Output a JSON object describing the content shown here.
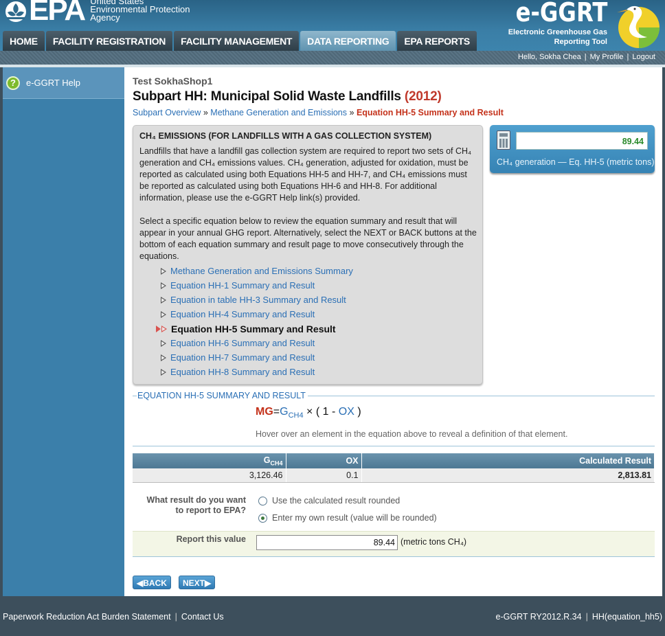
{
  "header": {
    "epa_wordmark": "EPA",
    "agency_line1": "United States",
    "agency_line2": "Environmental Protection",
    "agency_line3": "Agency",
    "app_wordmark": "e-GGRT",
    "app_subtitle_line1": "Electronic Greenhouse Gas",
    "app_subtitle_line2": "Reporting Tool"
  },
  "nav": {
    "tabs": [
      {
        "label": "HOME"
      },
      {
        "label": "FACILITY REGISTRATION"
      },
      {
        "label": "FACILITY MANAGEMENT"
      },
      {
        "label": "DATA REPORTING"
      },
      {
        "label": "EPA REPORTS"
      }
    ],
    "active_tab": "DATA REPORTING"
  },
  "userbar": {
    "greeting": "Hello, Sokha Chea",
    "profile": "My Profile",
    "logout": "Logout"
  },
  "sidebar": {
    "help_label": "e-GGRT Help"
  },
  "main": {
    "facility_name": "Test SokhaShop1",
    "title": "Subpart HH: Municipal Solid Waste Landfills",
    "title_year": "(2012)",
    "breadcrumb": {
      "item1": "Subpart Overview",
      "item2": "Methane Generation and Emissions",
      "current": "Equation HH-5 Summary and Result",
      "separator": "»"
    }
  },
  "info_box": {
    "title": "CH₄ EMISSIONS (FOR LANDFILLS WITH A GAS COLLECTION SYSTEM)",
    "paragraph1": "Landfills that have a landfill gas collection system are required to report two sets of CH₄ generation and CH₄ emissions values. CH₄ generation, adjusted for oxidation, must be reported as calculated using both Equations HH-5 and HH-7, and CH₄ emissions must be reported as calculated using both Equations HH-6 and HH-8. For additional information, please use the e-GGRT Help link(s) provided.",
    "paragraph2": "Select a specific equation below to review the equation summary and result that will appear in your annual GHG report. Alternatively, select the NEXT or BACK buttons at the bottom of each equation summary and result page to move consecutively through the equations.",
    "links": [
      {
        "label": "Methane Generation and Emissions Summary"
      },
      {
        "label": "Equation HH-1 Summary and Result"
      },
      {
        "label": "Equation in table HH-3 Summary and Result"
      },
      {
        "label": "Equation HH-4 Summary and Result"
      },
      {
        "label": "Equation HH-5 Summary and Result"
      },
      {
        "label": "Equation HH-6 Summary and Result"
      },
      {
        "label": "Equation HH-7 Summary and Result"
      },
      {
        "label": "Equation HH-8 Summary and Result"
      }
    ]
  },
  "result_box": {
    "value": "89.44",
    "caption": "CH₄ generation — Eq. HH-5 (metric tons)"
  },
  "equation": {
    "section_label": "EQUATION HH-5 SUMMARY AND RESULT",
    "result_var": "MG",
    "equals": "=",
    "g_var": "G",
    "g_sub": "CH4",
    "times": "×",
    "open": "(",
    "one": "1",
    "minus": "-",
    "ox_var": "OX",
    "close": ")",
    "hover_hint": "Hover over an element in the equation above to reveal a definition of that element."
  },
  "data_table": {
    "headers": {
      "g": "G",
      "g_sub": "CH4",
      "ox": "OX",
      "result": "Calculated Result"
    },
    "row": {
      "g": "3,126.46",
      "ox": "0.1",
      "result": "2,813.81"
    }
  },
  "question": {
    "label_line1": "What result do you want",
    "label_line2": "to report to EPA?",
    "option_calculated": "Use the calculated result rounded",
    "option_own": "Enter my own result (value will be rounded)",
    "selected": "own"
  },
  "report": {
    "label": "Report this value",
    "value": "89.44",
    "units": "(metric tons CH₄)"
  },
  "buttons": {
    "back": "BACK",
    "next": "NEXT"
  },
  "footer": {
    "paperwork": "Paperwork Reduction Act Burden Statement",
    "contact": "Contact Us",
    "version": "e-GGRT RY2012.R.34",
    "page_id": "HH(equation_hh5)"
  },
  "colors": {
    "accent_blue": "#2a6fb5",
    "alert_red": "#c4321b",
    "result_green": "#2a8a2a"
  }
}
